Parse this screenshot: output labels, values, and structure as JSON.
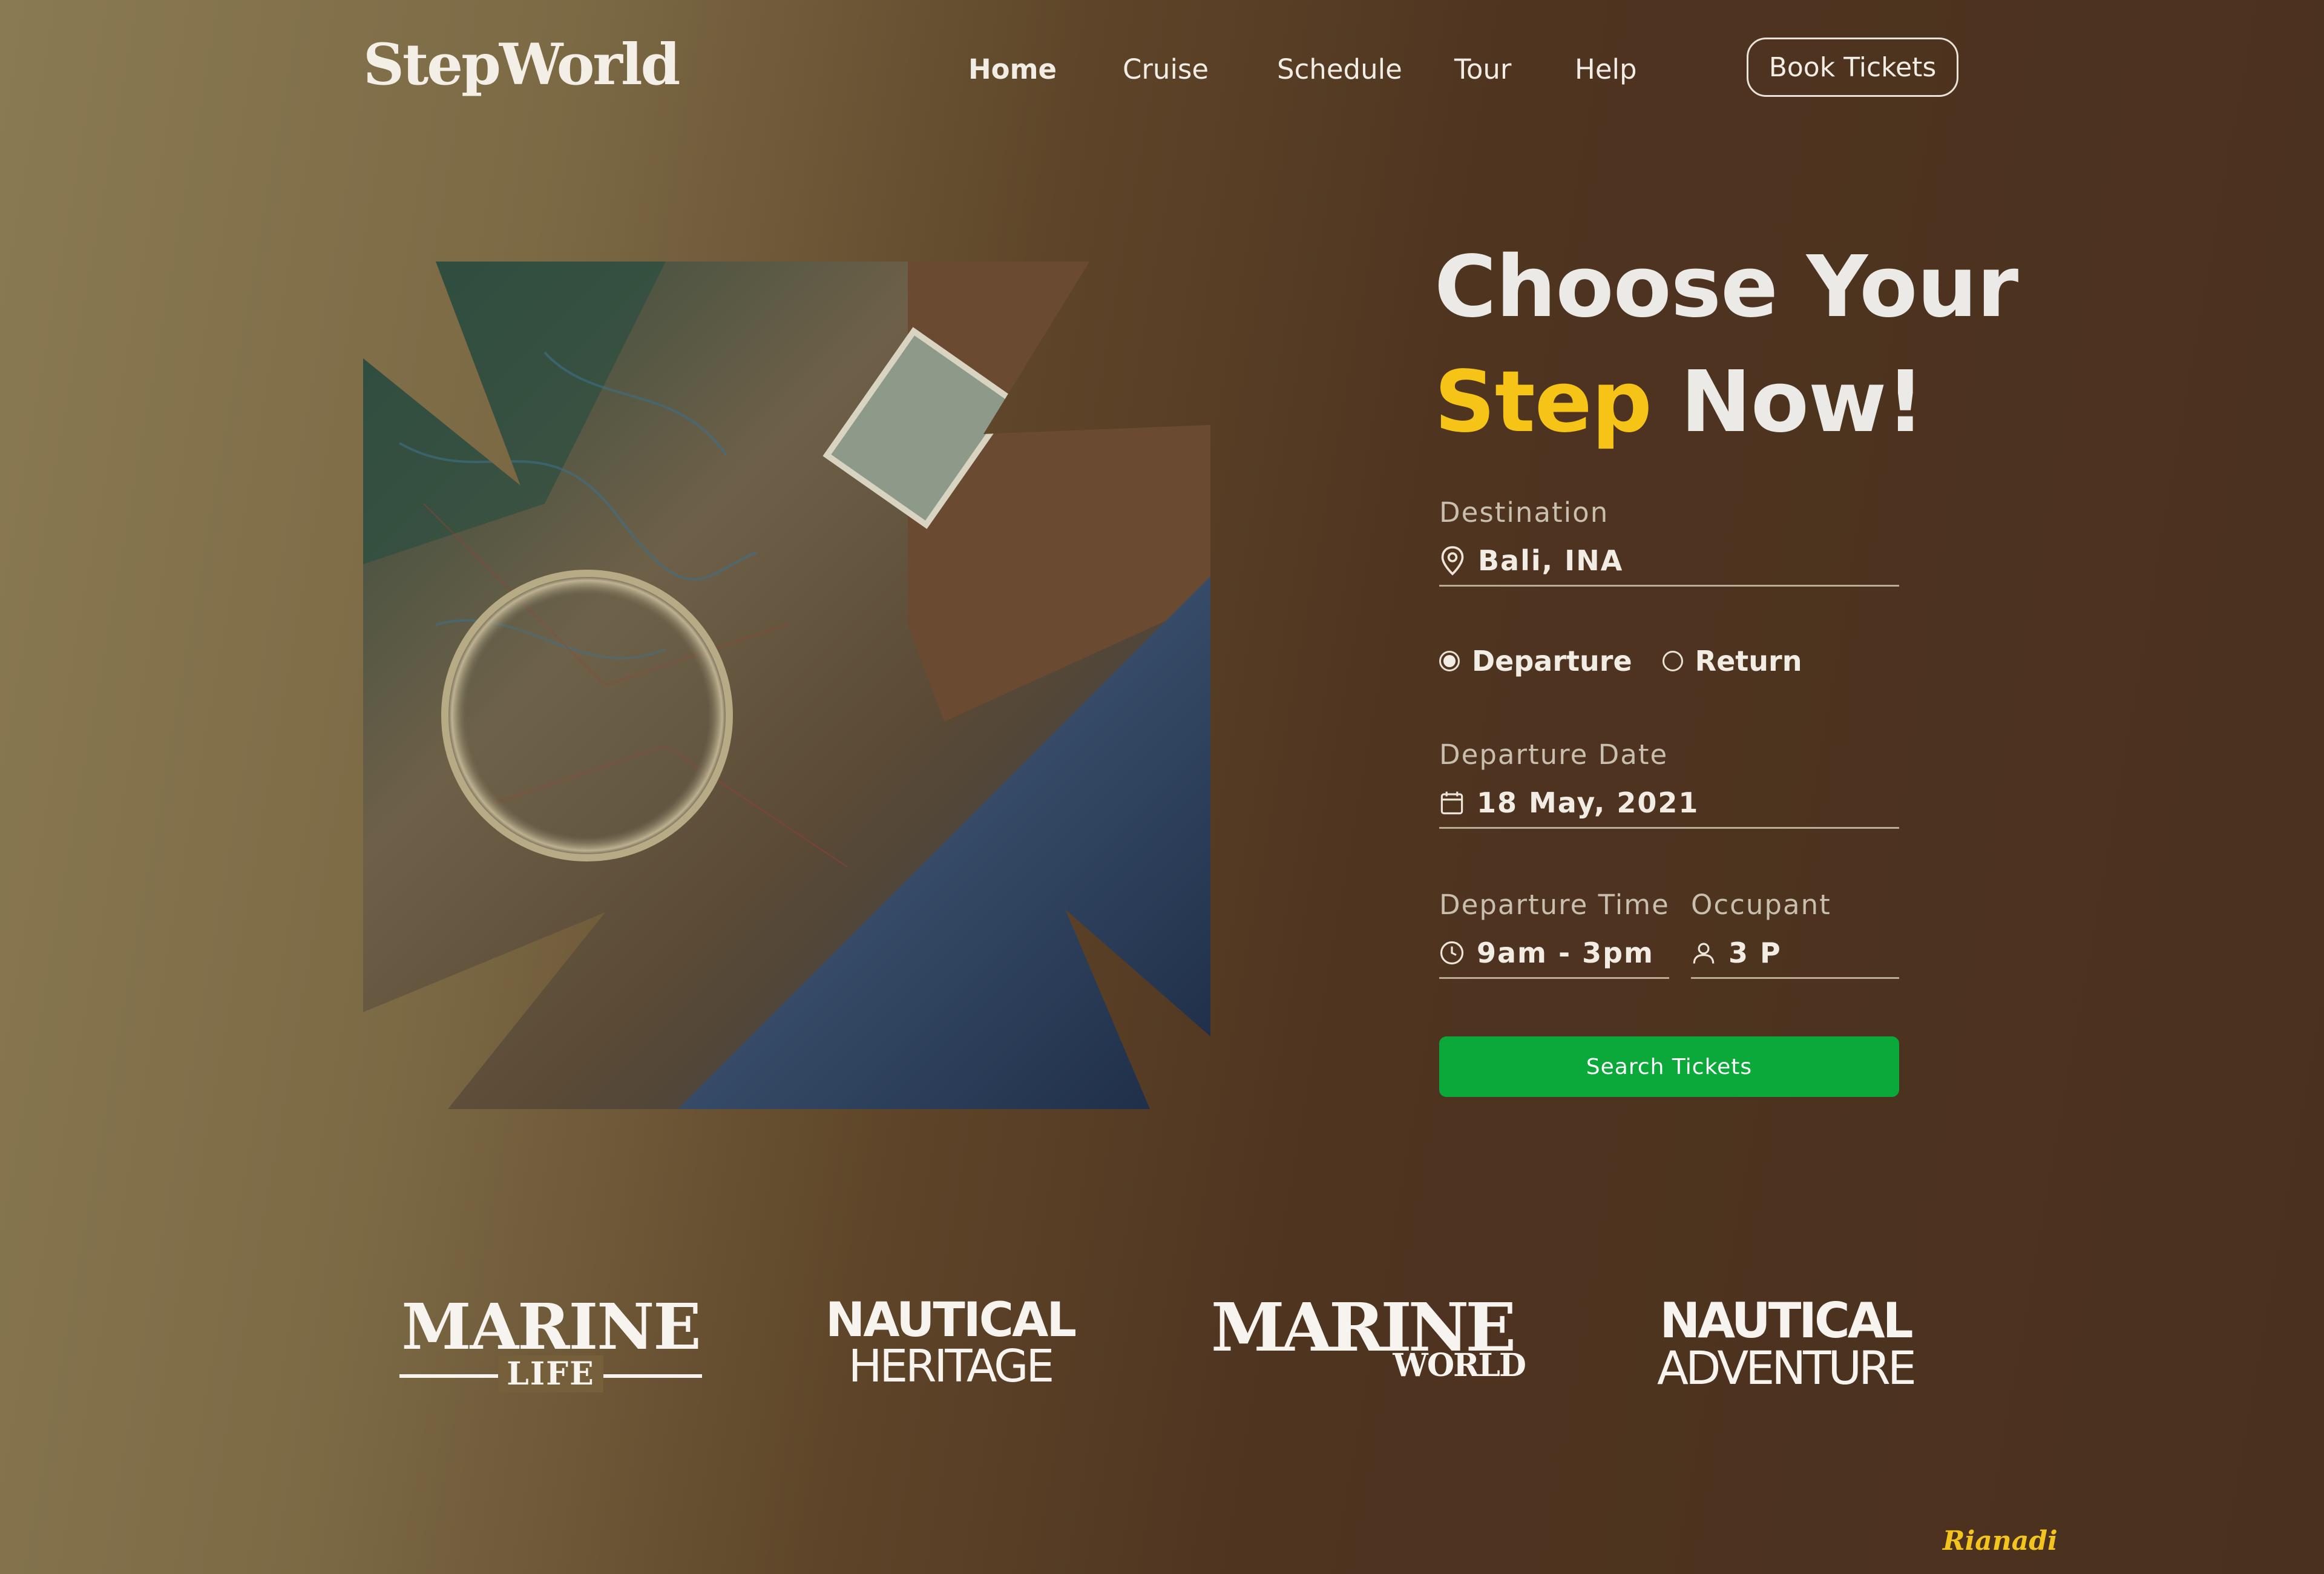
{
  "brand": "StepWorld",
  "nav": {
    "items": [
      "Home",
      "Cruise",
      "Schedule",
      "Tour",
      "Help"
    ],
    "active": "Home",
    "book_tickets": "Book Tickets"
  },
  "hero": {
    "headline_line1": "Choose Your",
    "headline_accent": "Step",
    "headline_rest": "Now!"
  },
  "form": {
    "destination": {
      "label": "Destination",
      "value": "Bali, INA",
      "icon": "location-pin-icon"
    },
    "trip_type": {
      "options": [
        "Departure",
        "Return"
      ],
      "selected": "Departure"
    },
    "departure_date": {
      "label": "Departure Date",
      "value": "18 May, 2021",
      "icon": "calendar-icon"
    },
    "departure_time": {
      "label": "Departure Time",
      "value": "9am - 3pm",
      "icon": "clock-icon"
    },
    "occupant": {
      "label": "Occupant",
      "value": "3 P",
      "icon": "user-icon"
    },
    "search_button": "Search Tickets"
  },
  "logos": [
    {
      "top": "MARINE",
      "bottom": "LIFE"
    },
    {
      "top": "NAUTICAL",
      "bottom": "HERITAGE"
    },
    {
      "top": "MARINE",
      "bottom": "WORLD"
    },
    {
      "top": "NAUTICAL",
      "bottom": "ADVENTURE"
    }
  ],
  "signature": "Rianadi",
  "colors": {
    "accent": "#f5c417",
    "button": "#0aa93a"
  }
}
